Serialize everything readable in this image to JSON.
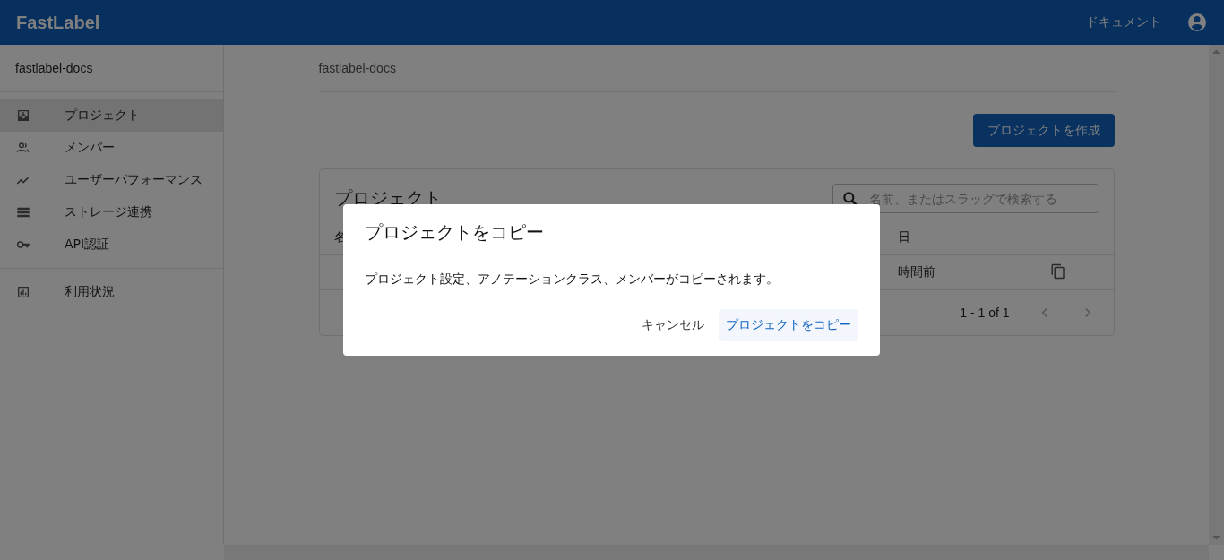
{
  "header": {
    "logo": "FastLabel",
    "docs_link": "ドキュメント"
  },
  "sidebar": {
    "org": "fastlabel-docs",
    "items": [
      {
        "label": "プロジェクト",
        "selected": true
      },
      {
        "label": "メンバー",
        "selected": false
      },
      {
        "label": "ユーザーパフォーマンス",
        "selected": false
      },
      {
        "label": "ストレージ連携",
        "selected": false
      },
      {
        "label": "API認証",
        "selected": false
      }
    ],
    "footer_items": [
      {
        "label": "利用状況",
        "selected": false
      }
    ]
  },
  "breadcrumb": "fastlabel-docs",
  "create_button": "プロジェクトを作成",
  "card": {
    "title": "プロジェクト",
    "search": {
      "placeholder": "名前、またはスラッグで検索する"
    },
    "columns": [
      "名",
      "日"
    ],
    "rows": [
      {
        "updated": "時間前"
      }
    ],
    "pagination": "1 - 1 of 1"
  },
  "dialog": {
    "title": "プロジェクトをコピー",
    "message": "プロジェクト設定、アノテーションクラス、メンバーがコピーされます。",
    "cancel": "キャンセル",
    "confirm": "プロジェクトをコピー"
  }
}
